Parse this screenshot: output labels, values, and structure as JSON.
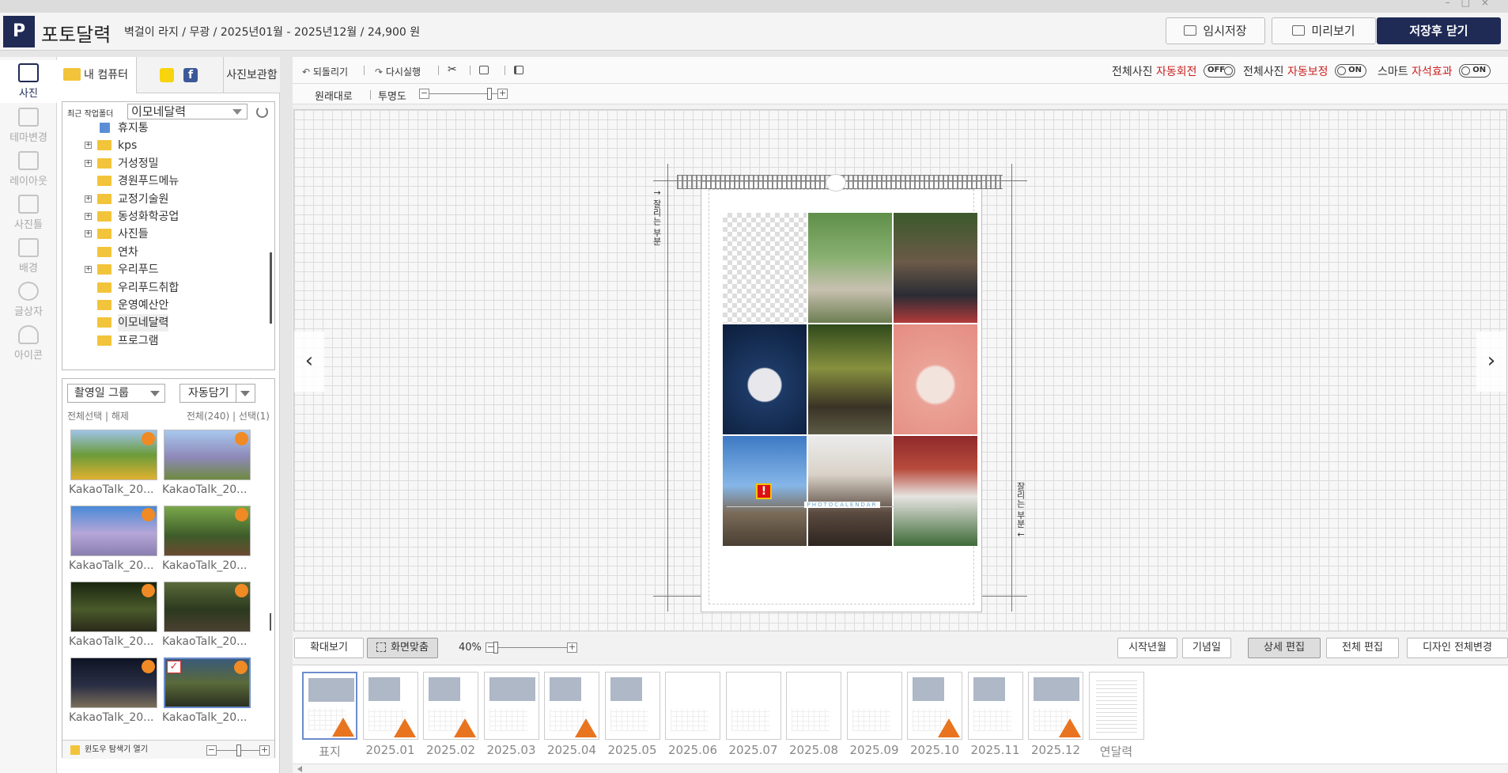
{
  "header": {
    "logo_letter": "P",
    "app_title": "포토달력",
    "product_info": "벽걸이 라지 / 무광 / 2025년01월 - 2025년12월 / 24,900 원",
    "buttons": {
      "temp_save": "임시저장",
      "preview": "미리보기",
      "save_close": "저장후 닫기"
    }
  },
  "tools": [
    {
      "label": "사진",
      "icon": "photo-icon",
      "active": true
    },
    {
      "label": "테마변경",
      "icon": "theme-icon",
      "active": false
    },
    {
      "label": "레이아웃",
      "icon": "layout-icon",
      "active": false
    },
    {
      "label": "사진틀",
      "icon": "frame-icon",
      "active": false
    },
    {
      "label": "배경",
      "icon": "background-icon",
      "active": false
    },
    {
      "label": "글상자",
      "icon": "textbox-icon",
      "active": false
    },
    {
      "label": "아이콘",
      "icon": "heart-icon",
      "active": false
    }
  ],
  "source_tabs": {
    "my_computer": "내 컴퓨터",
    "archive": "사진보관함"
  },
  "folder_panel": {
    "recent_label": "최근 작업폴더",
    "current_folder": "이모네달력",
    "tree": [
      {
        "name": "휴지통",
        "expandable": false
      },
      {
        "name": "kps",
        "expandable": true
      },
      {
        "name": "거성정밀",
        "expandable": true
      },
      {
        "name": "경원푸드메뉴",
        "expandable": false
      },
      {
        "name": "교정기술원",
        "expandable": true
      },
      {
        "name": "동성화학공업",
        "expandable": true
      },
      {
        "name": "사진들",
        "expandable": true
      },
      {
        "name": "연차",
        "expandable": false
      },
      {
        "name": "우리푸드",
        "expandable": true
      },
      {
        "name": "우리푸드취합",
        "expandable": false
      },
      {
        "name": "운영예산안",
        "expandable": false
      },
      {
        "name": "이모네달력",
        "expandable": false,
        "selected": true
      },
      {
        "name": "프로그램",
        "expandable": false
      }
    ]
  },
  "photo_list": {
    "group_select": "촬영일 그룹",
    "auto_load": "자동담기",
    "select_all": "전체선택 | 해제",
    "counts": "전체(240) | 선택(1)",
    "thumbs": [
      {
        "caption": "KakaoTalk_20...",
        "checked": false
      },
      {
        "caption": "KakaoTalk_20...",
        "checked": false
      },
      {
        "caption": "KakaoTalk_20...",
        "checked": false
      },
      {
        "caption": "KakaoTalk_20...",
        "checked": false
      },
      {
        "caption": "KakaoTalk_20...",
        "checked": false
      },
      {
        "caption": "KakaoTalk_20...",
        "checked": false
      },
      {
        "caption": "KakaoTalk_20...",
        "checked": false
      },
      {
        "caption": "KakaoTalk_20...",
        "checked": true
      }
    ],
    "open_explorer": "윈도우 탐색기 열기"
  },
  "toolbar": {
    "undo": "되돌리기",
    "redo": "다시실행",
    "auto_rotate_prefix": "전체사진 ",
    "auto_rotate_hl": "자동회전",
    "auto_rotate_state": "OFF",
    "auto_correct_prefix": "전체사진 ",
    "auto_correct_hl": "자동보정",
    "auto_correct_state": "ON",
    "smart_prefix": "스마트 ",
    "smart_hl": "자석효과",
    "smart_state": "ON",
    "original": "원래대로",
    "opacity": "투명도"
  },
  "canvas": {
    "cut_label": "잘리는 부분",
    "photo_calendar_text": "PHOTOCALENDAR"
  },
  "bottom_bar": {
    "zoom_in": "확대보기",
    "fit_screen": "화면맞춤",
    "zoom_level": "40%",
    "start_month": "시작년월",
    "anniversary": "기념일",
    "detail_edit": "상세 편집",
    "full_edit": "전체 편집",
    "design_change": "디자인 전체변경"
  },
  "filmstrip": [
    {
      "label": "표지",
      "warn": true,
      "active": true
    },
    {
      "label": "2025.01",
      "warn": true
    },
    {
      "label": "2025.02",
      "warn": true
    },
    {
      "label": "2025.03",
      "warn": false
    },
    {
      "label": "2025.04",
      "warn": true
    },
    {
      "label": "2025.05",
      "warn": false
    },
    {
      "label": "2025.06",
      "warn": false
    },
    {
      "label": "2025.07",
      "warn": false
    },
    {
      "label": "2025.08",
      "warn": false
    },
    {
      "label": "2025.09",
      "warn": false
    },
    {
      "label": "2025.10",
      "warn": true
    },
    {
      "label": "2025.11",
      "warn": false
    },
    {
      "label": "2025.12",
      "warn": true
    },
    {
      "label": "연달력",
      "warn": false
    }
  ],
  "colors": {
    "brand": "#1f2a55",
    "highlight": "#cc2222",
    "warning": "#e8741f"
  }
}
